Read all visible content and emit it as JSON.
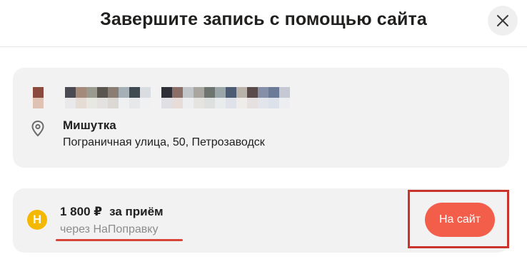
{
  "header": {
    "title": "Завершите запись с помощью сайта",
    "close_icon": "close-icon"
  },
  "clinic": {
    "name": "Мишутка",
    "address": "Пограничная улица, 50, Петрозаводск",
    "location_icon": "map-pin-icon",
    "redacted_doctor_name": true
  },
  "price": {
    "amount": "1 800 ₽",
    "suffix": "за приём",
    "via": "через НаПоправку",
    "provider_logo_letter": "Н",
    "provider_logo_color": "#f5b800"
  },
  "action": {
    "button_label": "На сайт",
    "button_color": "#f25e4a",
    "highlight_color": "#c9352c"
  }
}
